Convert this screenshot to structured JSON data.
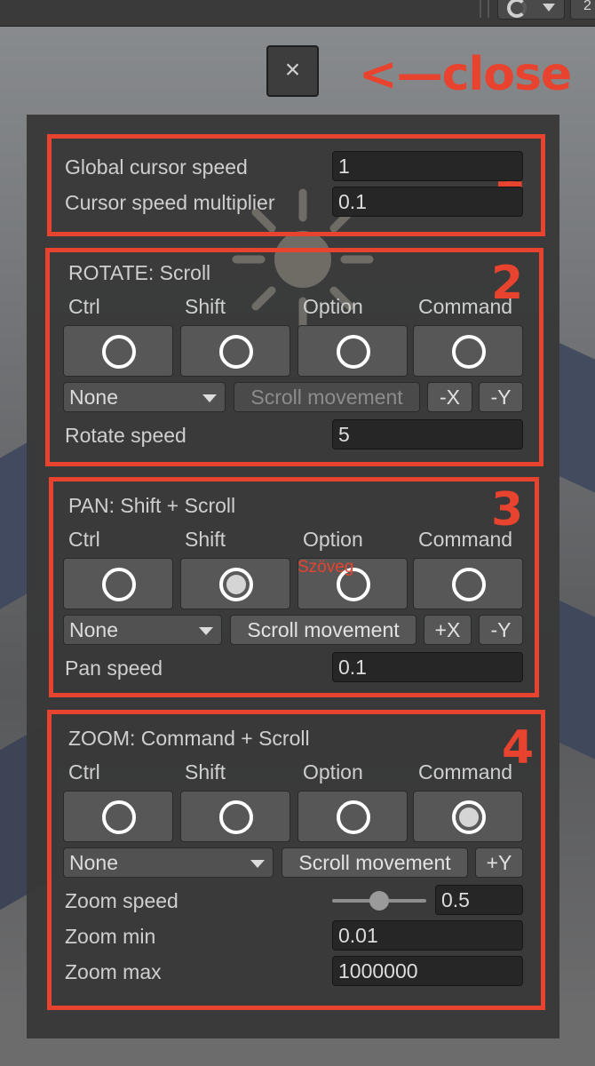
{
  "toolbar": {
    "right_button_partial": "2"
  },
  "close": {
    "label": "×",
    "annotation": "<—close"
  },
  "global": {
    "number": "1",
    "cursor_speed_label": "Global cursor speed",
    "cursor_speed_value": "1",
    "multiplier_label": "Cursor speed multiplier",
    "multiplier_value": "0.1"
  },
  "modifier_labels": [
    "Ctrl",
    "Shift",
    "Option",
    "Command"
  ],
  "rotate": {
    "number": "2",
    "title": "ROTATE: Scroll",
    "selected": [
      false,
      false,
      false,
      false
    ],
    "dropdown": "None",
    "scroll_movement": "Scroll movement",
    "axis_x": "-X",
    "axis_y": "-Y",
    "speed_label": "Rotate speed",
    "speed_value": "5"
  },
  "pan": {
    "number": "3",
    "title": "PAN: Shift + Scroll",
    "selected": [
      false,
      true,
      false,
      false
    ],
    "overlay_text": "Szöveg",
    "dropdown": "None",
    "scroll_movement": "Scroll movement",
    "axis_x": "+X",
    "axis_y": "-Y",
    "speed_label": "Pan speed",
    "speed_value": "0.1"
  },
  "zoom": {
    "number": "4",
    "title": "ZOOM: Command + Scroll",
    "selected": [
      false,
      false,
      false,
      true
    ],
    "dropdown": "None",
    "scroll_movement": "Scroll movement",
    "axis_y": "+Y",
    "speed_label": "Zoom speed",
    "speed_value": "0.5",
    "speed_slider_fraction": 0.5,
    "min_label": "Zoom min",
    "min_value": "0.01",
    "max_label": "Zoom max",
    "max_value": "1000000"
  },
  "colors": {
    "annotation_red": "#e8432e",
    "panel_bg": "#383838",
    "field_bg": "#262626"
  }
}
